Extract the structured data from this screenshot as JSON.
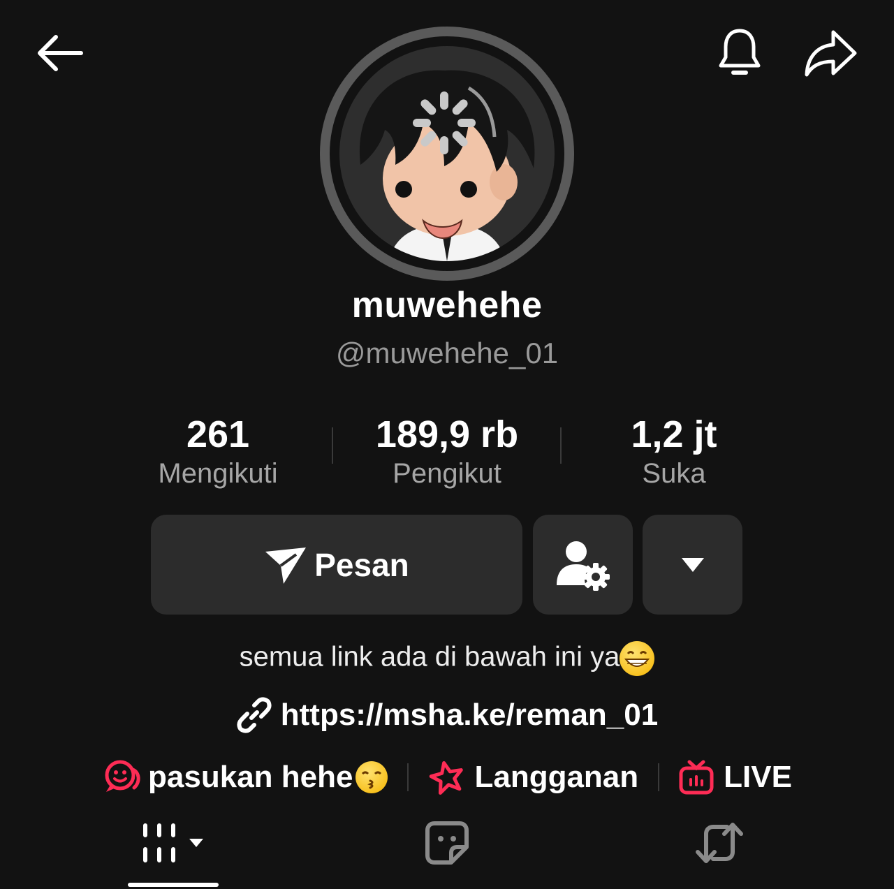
{
  "header": {
    "back_icon": "arrow-left-icon",
    "notification_icon": "bell-icon",
    "share_icon": "share-arrow-icon"
  },
  "profile": {
    "display_name": "muwehehe",
    "username": "@muwehehe_01"
  },
  "stats": [
    {
      "value": "261",
      "label": "Mengikuti"
    },
    {
      "value": "189,9 rb",
      "label": "Pengikut"
    },
    {
      "value": "1,2 jt",
      "label": "Suka"
    }
  ],
  "actions": {
    "message_label": "Pesan",
    "message_icon": "paper-plane-icon",
    "follow_settings_icon": "user-gear-icon",
    "more_icon": "caret-down-icon"
  },
  "bio": {
    "text": "semua link ada di bawah ini ya",
    "emoji": "grinning-face-emoji"
  },
  "link": {
    "url": "https://msha.ke/reman_01",
    "icon": "link-icon"
  },
  "pills": [
    {
      "label": "pasukan hehe",
      "icon": "group-chat-icon",
      "emoji": "kissing-face-emoji"
    },
    {
      "label": "Langganan",
      "icon": "star-subscription-icon"
    },
    {
      "label": "LIVE",
      "icon": "live-tv-icon"
    }
  ],
  "tabs": [
    {
      "name": "videos",
      "icon": "grid-icon"
    },
    {
      "name": "favorites",
      "icon": "sticker-icon"
    },
    {
      "name": "reposts",
      "icon": "repost-icon"
    }
  ],
  "colors": {
    "background": "#121212",
    "button": "#2c2c2c",
    "accent": "#fe2c55",
    "muted_text": "#9a9a9a"
  }
}
